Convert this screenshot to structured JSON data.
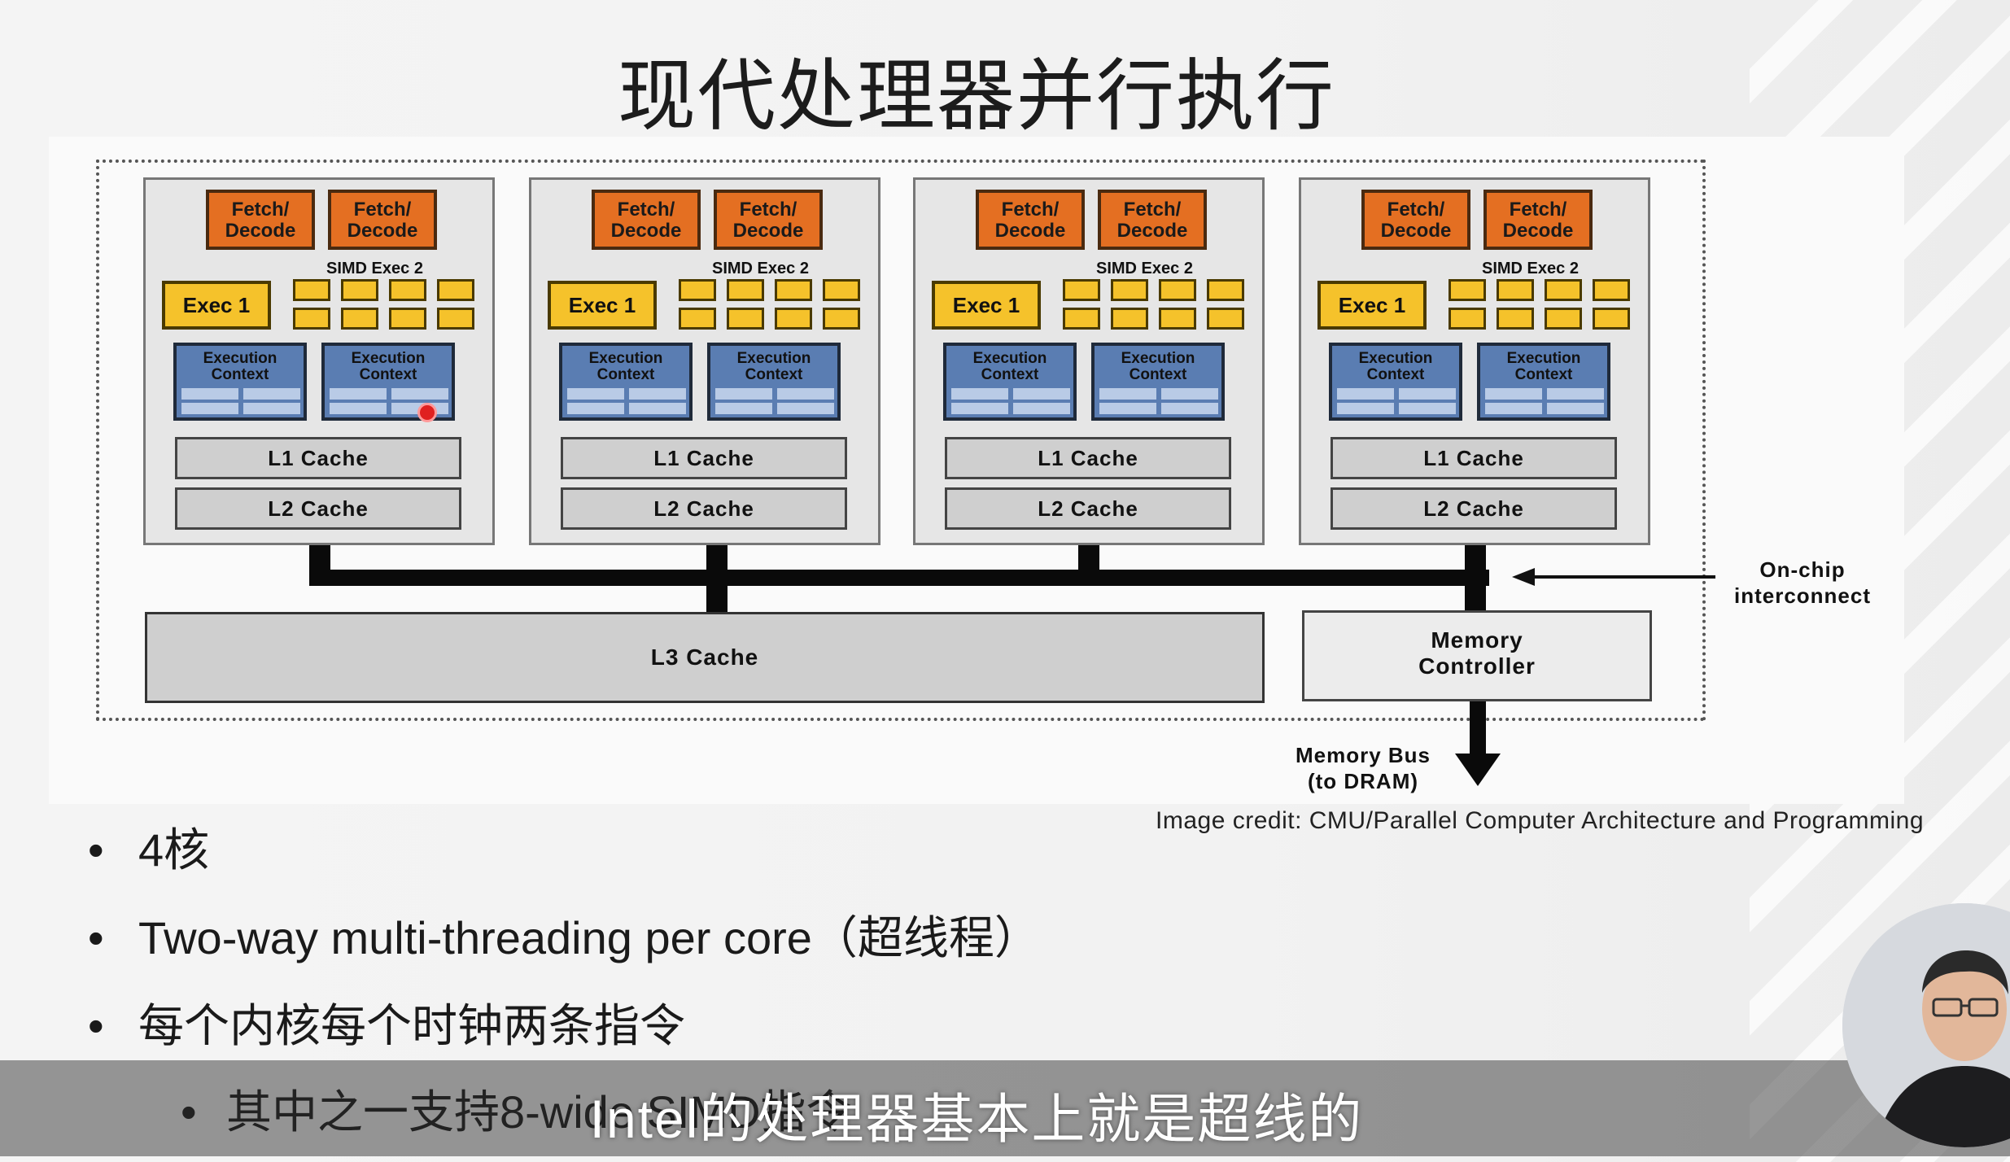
{
  "title": "现代处理器并行执行",
  "cores": [
    {
      "fetch_decode_1": "Fetch/\nDecode",
      "fetch_decode_2": "Fetch/\nDecode",
      "simd_label": "SIMD Exec 2",
      "exec1": "Exec 1",
      "ctx1": "Execution\nContext",
      "ctx2": "Execution\nContext",
      "l1": "L1 Cache",
      "l2": "L2 Cache"
    },
    {
      "fetch_decode_1": "Fetch/\nDecode",
      "fetch_decode_2": "Fetch/\nDecode",
      "simd_label": "SIMD Exec 2",
      "exec1": "Exec 1",
      "ctx1": "Execution\nContext",
      "ctx2": "Execution\nContext",
      "l1": "L1 Cache",
      "l2": "L2 Cache"
    },
    {
      "fetch_decode_1": "Fetch/\nDecode",
      "fetch_decode_2": "Fetch/\nDecode",
      "simd_label": "SIMD Exec 2",
      "exec1": "Exec 1",
      "ctx1": "Execution\nContext",
      "ctx2": "Execution\nContext",
      "l1": "L1 Cache",
      "l2": "L2 Cache"
    },
    {
      "fetch_decode_1": "Fetch/\nDecode",
      "fetch_decode_2": "Fetch/\nDecode",
      "simd_label": "SIMD Exec 2",
      "exec1": "Exec 1",
      "ctx1": "Execution\nContext",
      "ctx2": "Execution\nContext",
      "l1": "L1 Cache",
      "l2": "L2 Cache"
    }
  ],
  "l3": "L3 Cache",
  "memory_controller": "Memory\nController",
  "onchip_interconnect": "On-chip\ninterconnect",
  "memory_bus": "Memory Bus\n(to DRAM)",
  "credit": "Image credit: CMU/Parallel Computer Architecture and Programming",
  "bullets": [
    "4核",
    "Two-way multi-threading per core（超线程）",
    "每个内核每个时钟两条指令"
  ],
  "sub_bullet": "其中之一支持8-wide SIMD指令",
  "subtitle": "Intel的处理器基本上就是超线的",
  "colors": {
    "fetch_decode": "#e46f22",
    "exec": "#f5c22b",
    "context": "#5a7db2",
    "cache": "#cfcfcf",
    "bus": "#0a0a0a"
  }
}
